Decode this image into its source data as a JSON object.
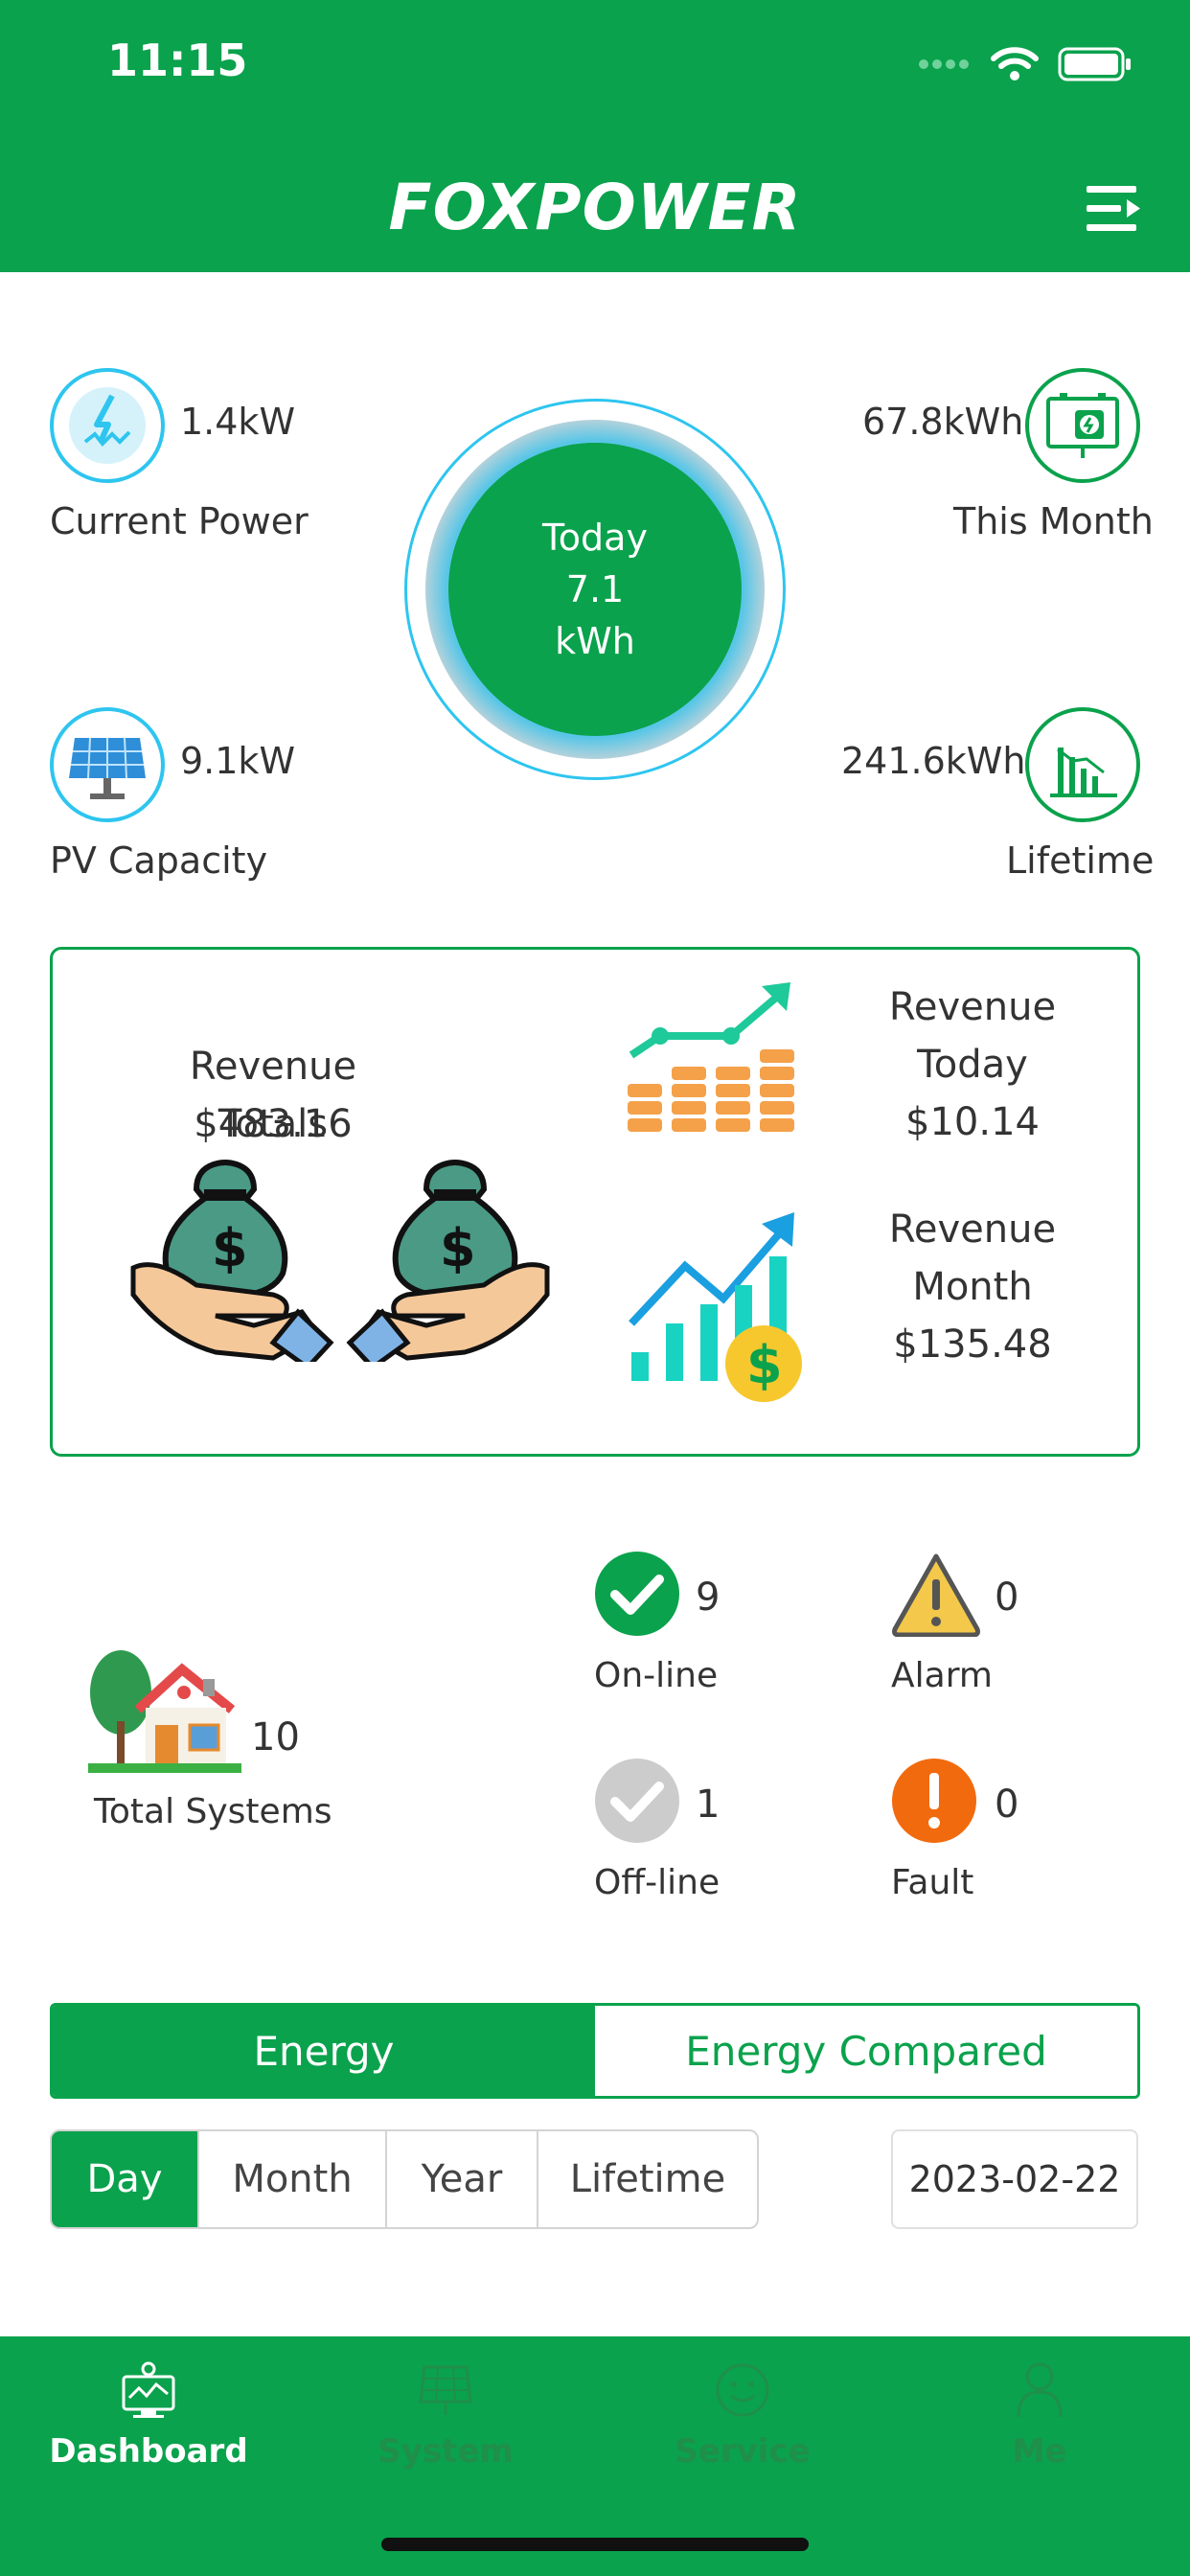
{
  "status_bar": {
    "time": "11:15"
  },
  "header": {
    "logo_text": "FOXPOWER"
  },
  "stats": {
    "current_power": {
      "value": "1.4kW",
      "label": "Current Power"
    },
    "pv_capacity": {
      "value": "9.1kW",
      "label": "PV Capacity"
    },
    "this_month": {
      "value": "67.8kWh",
      "label": "This Month"
    },
    "lifetime": {
      "value": "241.6kWh",
      "label": "Lifetime"
    },
    "today": {
      "line1": "Today",
      "line2": "7.1",
      "line3": "kWh"
    }
  },
  "revenue": {
    "totals_label": "Revenue Totals",
    "totals_value": "$483.16",
    "today_line1": "Revenue",
    "today_line2": "Today",
    "today_value": "$10.14",
    "month_line1": "Revenue",
    "month_line2": "Month",
    "month_value": "$135.48"
  },
  "systems": {
    "total": {
      "count": "10",
      "label": "Total Systems"
    },
    "online": {
      "count": "9",
      "label": "On-line"
    },
    "alarm": {
      "count": "0",
      "label": "Alarm"
    },
    "offline": {
      "count": "1",
      "label": "Off-line"
    },
    "fault": {
      "count": "0",
      "label": "Fault"
    }
  },
  "energy_tabs": {
    "energy": "Energy",
    "energy_compared": "Energy Compared",
    "selected": "Energy"
  },
  "period_tabs": {
    "day": "Day",
    "month": "Month",
    "year": "Year",
    "lifetime": "Lifetime",
    "selected": "Day"
  },
  "date": "2023-02-22",
  "bottom_nav": {
    "dashboard": "Dashboard",
    "system": "System",
    "service": "Service",
    "me": "Me",
    "selected": "Dashboard"
  },
  "colors": {
    "brand_green": "#0aa24c",
    "accent_blue": "#2ec5ef",
    "alarm_yellow": "#f3c84b",
    "fault_orange": "#f26a0e",
    "offline_gray": "#cccccc"
  },
  "icons": [
    "wifi-icon",
    "battery-icon",
    "menu-icon",
    "lightning-icon",
    "solar-panel-icon",
    "monitor-icon",
    "bar-chart-icon",
    "money-bag-hands-icon",
    "coins-growth-icon",
    "growth-dollar-icon",
    "house-icon",
    "check-icon",
    "warning-icon",
    "offline-check-icon",
    "fault-icon",
    "dashboard-icon",
    "system-icon",
    "service-icon",
    "me-icon"
  ]
}
